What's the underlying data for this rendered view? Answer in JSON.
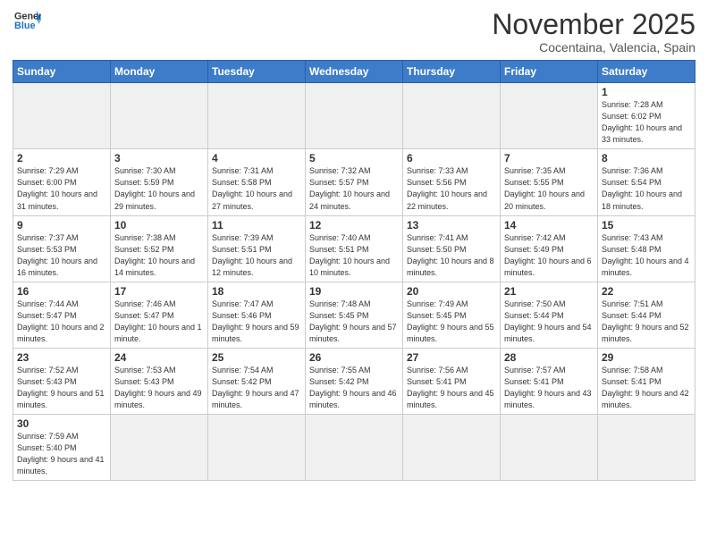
{
  "logo": {
    "line1": "General",
    "line2": "Blue"
  },
  "title": "November 2025",
  "subtitle": "Cocentaina, Valencia, Spain",
  "headers": [
    "Sunday",
    "Monday",
    "Tuesday",
    "Wednesday",
    "Thursday",
    "Friday",
    "Saturday"
  ],
  "weeks": [
    [
      {
        "num": "",
        "info": "",
        "empty": true
      },
      {
        "num": "",
        "info": "",
        "empty": true
      },
      {
        "num": "",
        "info": "",
        "empty": true
      },
      {
        "num": "",
        "info": "",
        "empty": true
      },
      {
        "num": "",
        "info": "",
        "empty": true
      },
      {
        "num": "",
        "info": "",
        "empty": true
      },
      {
        "num": "1",
        "info": "Sunrise: 7:28 AM\nSunset: 6:02 PM\nDaylight: 10 hours\nand 33 minutes."
      }
    ],
    [
      {
        "num": "2",
        "info": "Sunrise: 7:29 AM\nSunset: 6:00 PM\nDaylight: 10 hours\nand 31 minutes."
      },
      {
        "num": "3",
        "info": "Sunrise: 7:30 AM\nSunset: 5:59 PM\nDaylight: 10 hours\nand 29 minutes."
      },
      {
        "num": "4",
        "info": "Sunrise: 7:31 AM\nSunset: 5:58 PM\nDaylight: 10 hours\nand 27 minutes."
      },
      {
        "num": "5",
        "info": "Sunrise: 7:32 AM\nSunset: 5:57 PM\nDaylight: 10 hours\nand 24 minutes."
      },
      {
        "num": "6",
        "info": "Sunrise: 7:33 AM\nSunset: 5:56 PM\nDaylight: 10 hours\nand 22 minutes."
      },
      {
        "num": "7",
        "info": "Sunrise: 7:35 AM\nSunset: 5:55 PM\nDaylight: 10 hours\nand 20 minutes."
      },
      {
        "num": "8",
        "info": "Sunrise: 7:36 AM\nSunset: 5:54 PM\nDaylight: 10 hours\nand 18 minutes."
      }
    ],
    [
      {
        "num": "9",
        "info": "Sunrise: 7:37 AM\nSunset: 5:53 PM\nDaylight: 10 hours\nand 16 minutes."
      },
      {
        "num": "10",
        "info": "Sunrise: 7:38 AM\nSunset: 5:52 PM\nDaylight: 10 hours\nand 14 minutes."
      },
      {
        "num": "11",
        "info": "Sunrise: 7:39 AM\nSunset: 5:51 PM\nDaylight: 10 hours\nand 12 minutes."
      },
      {
        "num": "12",
        "info": "Sunrise: 7:40 AM\nSunset: 5:51 PM\nDaylight: 10 hours\nand 10 minutes."
      },
      {
        "num": "13",
        "info": "Sunrise: 7:41 AM\nSunset: 5:50 PM\nDaylight: 10 hours\nand 8 minutes."
      },
      {
        "num": "14",
        "info": "Sunrise: 7:42 AM\nSunset: 5:49 PM\nDaylight: 10 hours\nand 6 minutes."
      },
      {
        "num": "15",
        "info": "Sunrise: 7:43 AM\nSunset: 5:48 PM\nDaylight: 10 hours\nand 4 minutes."
      }
    ],
    [
      {
        "num": "16",
        "info": "Sunrise: 7:44 AM\nSunset: 5:47 PM\nDaylight: 10 hours\nand 2 minutes."
      },
      {
        "num": "17",
        "info": "Sunrise: 7:46 AM\nSunset: 5:47 PM\nDaylight: 10 hours\nand 1 minute."
      },
      {
        "num": "18",
        "info": "Sunrise: 7:47 AM\nSunset: 5:46 PM\nDaylight: 9 hours\nand 59 minutes."
      },
      {
        "num": "19",
        "info": "Sunrise: 7:48 AM\nSunset: 5:45 PM\nDaylight: 9 hours\nand 57 minutes."
      },
      {
        "num": "20",
        "info": "Sunrise: 7:49 AM\nSunset: 5:45 PM\nDaylight: 9 hours\nand 55 minutes."
      },
      {
        "num": "21",
        "info": "Sunrise: 7:50 AM\nSunset: 5:44 PM\nDaylight: 9 hours\nand 54 minutes."
      },
      {
        "num": "22",
        "info": "Sunrise: 7:51 AM\nSunset: 5:44 PM\nDaylight: 9 hours\nand 52 minutes."
      }
    ],
    [
      {
        "num": "23",
        "info": "Sunrise: 7:52 AM\nSunset: 5:43 PM\nDaylight: 9 hours\nand 51 minutes."
      },
      {
        "num": "24",
        "info": "Sunrise: 7:53 AM\nSunset: 5:43 PM\nDaylight: 9 hours\nand 49 minutes."
      },
      {
        "num": "25",
        "info": "Sunrise: 7:54 AM\nSunset: 5:42 PM\nDaylight: 9 hours\nand 47 minutes."
      },
      {
        "num": "26",
        "info": "Sunrise: 7:55 AM\nSunset: 5:42 PM\nDaylight: 9 hours\nand 46 minutes."
      },
      {
        "num": "27",
        "info": "Sunrise: 7:56 AM\nSunset: 5:41 PM\nDaylight: 9 hours\nand 45 minutes."
      },
      {
        "num": "28",
        "info": "Sunrise: 7:57 AM\nSunset: 5:41 PM\nDaylight: 9 hours\nand 43 minutes."
      },
      {
        "num": "29",
        "info": "Sunrise: 7:58 AM\nSunset: 5:41 PM\nDaylight: 9 hours\nand 42 minutes."
      }
    ],
    [
      {
        "num": "30",
        "info": "Sunrise: 7:59 AM\nSunset: 5:40 PM\nDaylight: 9 hours\nand 41 minutes."
      },
      {
        "num": "",
        "info": "",
        "empty": true
      },
      {
        "num": "",
        "info": "",
        "empty": true
      },
      {
        "num": "",
        "info": "",
        "empty": true
      },
      {
        "num": "",
        "info": "",
        "empty": true
      },
      {
        "num": "",
        "info": "",
        "empty": true
      },
      {
        "num": "",
        "info": "",
        "empty": true
      }
    ]
  ]
}
